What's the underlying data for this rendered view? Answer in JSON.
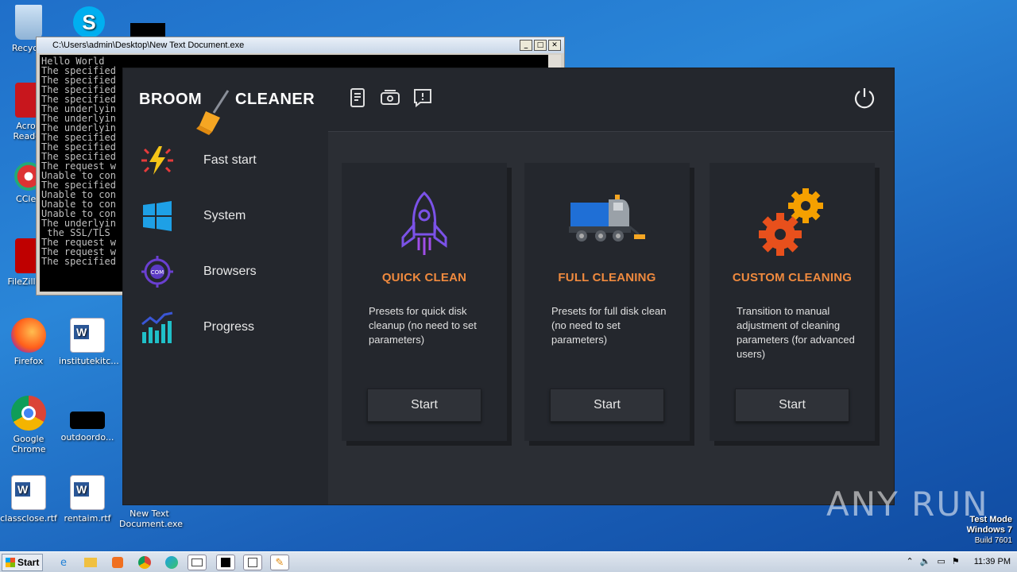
{
  "desktop": {
    "icons": [
      {
        "label": "Recycle"
      },
      {
        "label": "Acrob Reader"
      },
      {
        "label": "CClea"
      },
      {
        "label": "FileZilla C"
      },
      {
        "label": "Firefox"
      },
      {
        "label": "institutekitc..."
      },
      {
        "label": "Google Chrome"
      },
      {
        "label": "outdoordo..."
      },
      {
        "label": "classclose.rtf"
      },
      {
        "label": "rentaim.rtf"
      },
      {
        "label": "New Text Document.exe"
      }
    ]
  },
  "console": {
    "title": "C:\\Users\\admin\\Desktop\\New Text Document.exe",
    "lines": [
      "Hello World",
      "The specified",
      "The specified",
      "The specified",
      "The specified",
      "The underlyin",
      "The underlyin",
      "The underlyin",
      "The specified",
      "The specified",
      "The specified",
      "The request w",
      "Unable to con",
      "The specified",
      "Unable to con",
      "Unable to con",
      "Unable to con",
      "The underlyin",
      " the SSL/TLS",
      "The request w",
      "The request w",
      "The specified"
    ]
  },
  "app": {
    "logo_left": "BROOM",
    "logo_right": "CLEANER",
    "nav": [
      {
        "label": "Fast start",
        "icon": "lightning-icon"
      },
      {
        "label": "System",
        "icon": "windows-icon"
      },
      {
        "label": "Browsers",
        "icon": "browser-target-icon"
      },
      {
        "label": "Progress",
        "icon": "chart-icon"
      }
    ],
    "cards": [
      {
        "title": "QUICK CLEAN",
        "desc": "Presets for quick disk cleanup (no need to set parameters)",
        "button": "Start",
        "icon": "rocket-icon"
      },
      {
        "title": "FULL CLEANING",
        "desc": "Presets for full disk clean (no need to set parameters)",
        "button": "Start",
        "icon": "sweeper-truck-icon"
      },
      {
        "title": "CUSTOM CLEANING",
        "desc": "Transition to manual adjustment of cleaning parameters (for advanced users)",
        "button": "Start",
        "icon": "gears-icon"
      }
    ]
  },
  "watermark": "ANY RUN",
  "testmode": {
    "line1": "Test Mode",
    "line2": "Windows 7",
    "line3": "Build 7601"
  },
  "taskbar": {
    "start": "Start",
    "clock": "11:39 PM"
  },
  "colors": {
    "accent": "#f08a3e",
    "app_bg": "#2b2e34",
    "panel": "#24272d"
  }
}
